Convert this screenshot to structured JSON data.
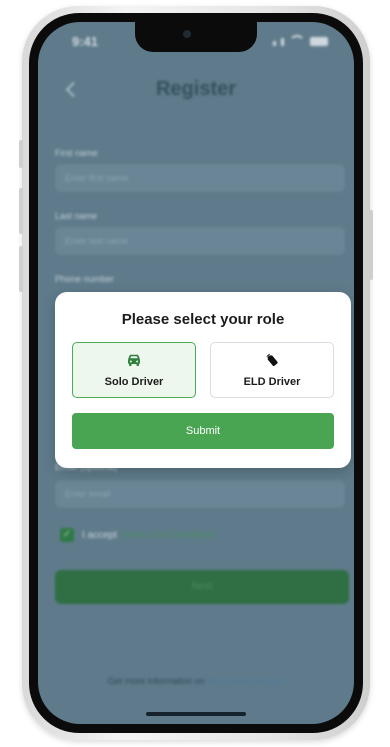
{
  "status_bar": {
    "time": "9:41"
  },
  "header": {
    "title": "Register"
  },
  "form": {
    "first_name": {
      "label": "First name",
      "placeholder": "Enter first name"
    },
    "last_name": {
      "label": "Last name",
      "placeholder": "Enter last name"
    },
    "phone": {
      "label": "Phone number"
    },
    "email": {
      "label": "Email (optional)",
      "placeholder": "Enter email"
    },
    "accept": {
      "text": "I accept",
      "link": "Terms and Conditions",
      "checked": true
    },
    "next_label": "Next"
  },
  "footer": {
    "text": "Get more information on",
    "link": "https://eldlogic.com"
  },
  "modal": {
    "title": "Please select your role",
    "options": [
      {
        "label": "Solo Driver",
        "icon": "car-icon",
        "selected": true
      },
      {
        "label": "ELD Driver",
        "icon": "eld-device-icon",
        "selected": false
      }
    ],
    "submit_label": "Submit"
  },
  "colors": {
    "accent": "#4aa553",
    "selected_border": "#4aaa55",
    "overlay": "#5f7b8b"
  }
}
